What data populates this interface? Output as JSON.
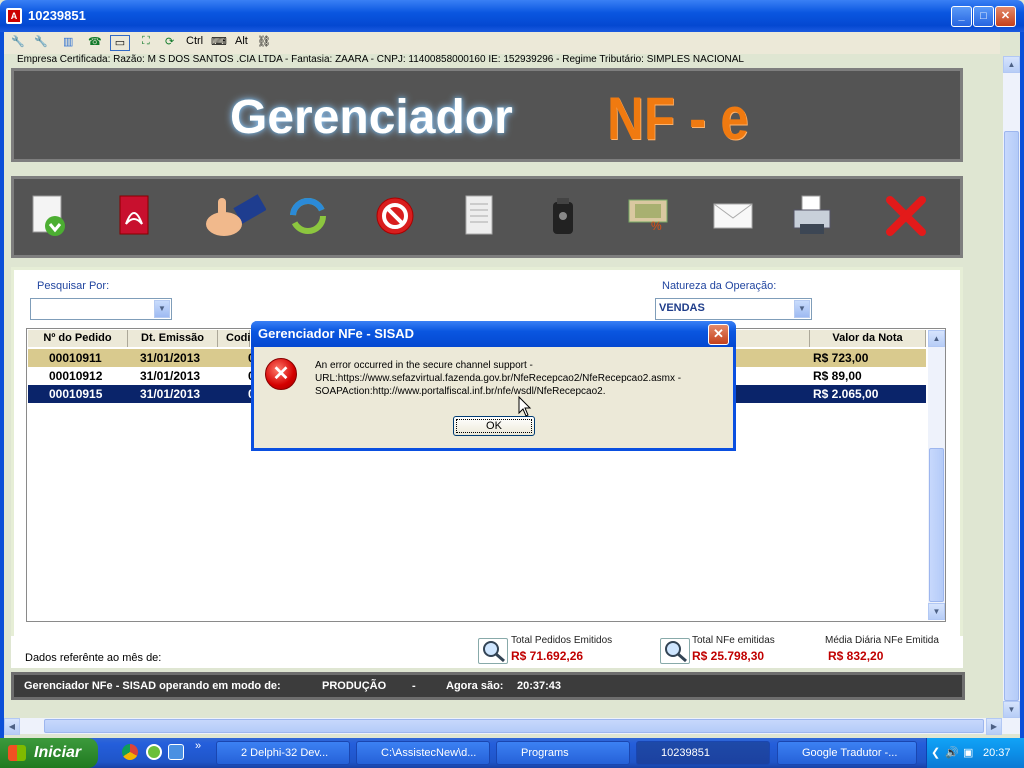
{
  "window": {
    "title": "10239851",
    "app_icon": "A"
  },
  "toolbar": {
    "ctrl_label": "Ctrl",
    "alt_label": "Alt"
  },
  "info_line": "Empresa Certificada:  Razão: M S DOS SANTOS .CIA LTDA - Fantasia: ZAARA - CNPJ: 11400858000160   IE: 152939296  -  Regime Tributário: SIMPLES NACIONAL",
  "banner": {
    "title_left": "Gerenciador",
    "title_right": "NF - e"
  },
  "toolbar_icons": [
    "new-document-icon",
    "pdf-icon",
    "thumbs-up-icon",
    "refresh-icon",
    "cancel-icon",
    "document-icon",
    "trash-icon",
    "money-icon",
    "mail-icon",
    "printer-icon",
    "close-red-icon"
  ],
  "search": {
    "label": "Pesquisar Por:",
    "value": ""
  },
  "nature": {
    "label": "Natureza da Operação:",
    "value": "VENDAS"
  },
  "table": {
    "columns": [
      "Nº do Pedido",
      "Dt. Emissão",
      "Codi",
      "Valor da Nota"
    ],
    "rows": [
      {
        "pedido": "00010911",
        "data": "31/01/2013",
        "codigo": "0",
        "valor": "R$ 723,00"
      },
      {
        "pedido": "00010912",
        "data": "31/01/2013",
        "codigo": "0",
        "valor": "R$ 89,00"
      },
      {
        "pedido": "00010915",
        "data": "31/01/2013",
        "codigo": "0",
        "valor": "R$ 2.065,00"
      }
    ]
  },
  "footer": {
    "month_label": "Dados referênte ao mês de:",
    "total_pedidos_label": "Total Pedidos Emitidos",
    "total_pedidos_value": "R$ 71.692,26",
    "total_nfe_label": "Total NFe emitidas",
    "total_nfe_value": "R$ 25.798,30",
    "media_label": "Média Diária NFe Emitida",
    "media_value": "R$ 832,20"
  },
  "status": {
    "operating": "Gerenciador NFe - SISAD operando em modo de:",
    "mode": "PRODUÇÃO",
    "sep": "-",
    "now_label": "Agora são:",
    "time": "20:37:43"
  },
  "dialog": {
    "title": "Gerenciador NFe - SISAD",
    "line1": "An error occurred in the secure channel support -",
    "line2": "URL:https://www.sefazvirtual.fazenda.gov.br/NfeRecepcao2/NfeRecepcao2.asmx -",
    "line3": "SOAPAction:http://www.portalfiscal.inf.br/nfe/wsdl/NfeRecepcao2.",
    "ok": "OK"
  },
  "taskbar": {
    "start": "Iniciar",
    "items": [
      "2 Delphi-32 Dev...",
      "C:\\AssistecNew\\d...",
      "Programs",
      "10239851",
      "Google Tradutor -..."
    ],
    "clock": "20:37"
  },
  "colors": {
    "selected_row": "#0a246a",
    "highlight_row": "#d9ca8e",
    "value_red": "#c00000",
    "nfe_orange": "#f07a10"
  }
}
